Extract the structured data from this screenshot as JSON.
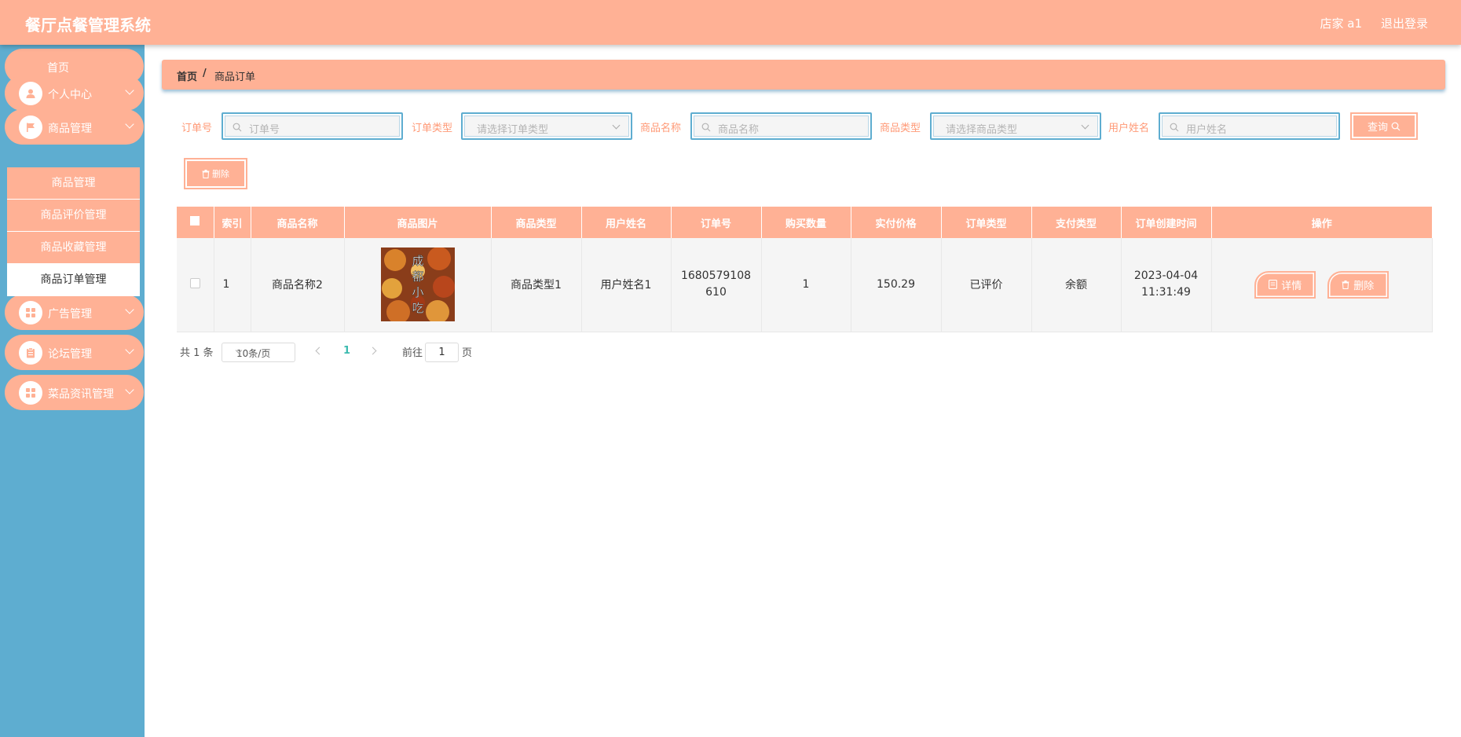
{
  "header": {
    "title": "餐厅点餐管理系统",
    "user": "店家 a1",
    "logout": "退出登录"
  },
  "sidebar": {
    "home": "首页",
    "menus": [
      {
        "label": "个人中心",
        "icon": "user-icon"
      },
      {
        "label": "商品管理",
        "icon": "flag-icon"
      },
      {
        "label": "广告管理",
        "icon": "grid-icon"
      },
      {
        "label": "论坛管理",
        "icon": "clipboard-icon"
      },
      {
        "label": "菜品资讯管理",
        "icon": "grid-icon"
      }
    ],
    "submenu": [
      "商品管理",
      "商品评价管理",
      "商品收藏管理",
      "商品订单管理"
    ]
  },
  "breadcrumb": {
    "home": "首页",
    "separator": "/",
    "current": "商品订单"
  },
  "search": {
    "order_no": {
      "label": "订单号",
      "placeholder": "订单号"
    },
    "order_type": {
      "label": "订单类型",
      "placeholder": "请选择订单类型"
    },
    "goods_name": {
      "label": "商品名称",
      "placeholder": "商品名称"
    },
    "goods_type": {
      "label": "商品类型",
      "placeholder": "请选择商品类型"
    },
    "user_name": {
      "label": "用户姓名",
      "placeholder": "用户姓名"
    },
    "query_button": "查询",
    "delete_button": "删除"
  },
  "table": {
    "columns": [
      "索引",
      "商品名称",
      "商品图片",
      "商品类型",
      "用户姓名",
      "订单号",
      "购买数量",
      "实付价格",
      "订单类型",
      "支付类型",
      "订单创建时间",
      "操作"
    ],
    "rows": [
      {
        "index": "1",
        "goods_name": "商品名称2",
        "image_text": "成都小吃",
        "goods_type": "商品类型1",
        "user_name": "用户姓名1",
        "order_no": "1680579108610",
        "quantity": "1",
        "price": "150.29",
        "order_type": "已评价",
        "pay_type": "余额",
        "created_at": "2023-04-04 11:31:49",
        "detail_button": "详情",
        "delete_button": "删除"
      }
    ]
  },
  "pagination": {
    "total": "共 1 条",
    "page_size": "10条/页",
    "current_page": "1",
    "goto_label": "前往",
    "goto_value": "1",
    "page_suffix": "页"
  },
  "colors": {
    "primary": "#ffb195",
    "sidebar": "#5eadd0",
    "label": "#ff9a77",
    "page_active": "#3dbbb0"
  }
}
